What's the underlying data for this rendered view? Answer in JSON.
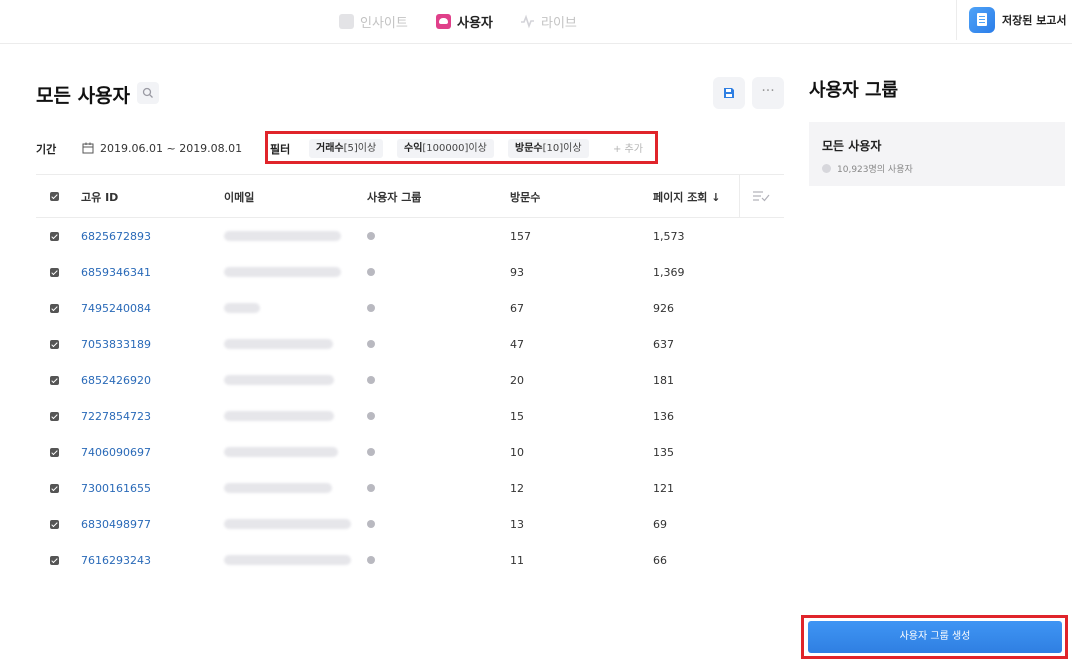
{
  "nav": {
    "tabs": [
      {
        "label": "인사이트",
        "icon": "lightbulb-icon"
      },
      {
        "label": "사용자",
        "icon": "users-icon"
      },
      {
        "label": "라이브",
        "icon": "pulse-icon"
      }
    ],
    "active_tab": "사용자",
    "saved_reports_label": "저장된 보고서"
  },
  "header": {
    "title": "모든 사용자"
  },
  "period": {
    "label": "기간",
    "value": "2019.06.01 ~ 2019.08.01"
  },
  "filters": {
    "label": "필터",
    "chips": [
      {
        "name": "거래수",
        "value": "[5]이상"
      },
      {
        "name": "수익",
        "value": "[100000]이상"
      },
      {
        "name": "방문수",
        "value": "[10]이상"
      }
    ],
    "add_label": "+ 추가"
  },
  "table": {
    "columns": [
      "고유 ID",
      "이메일",
      "사용자 그룹",
      "방문수",
      "페이지 조회 ↓"
    ],
    "rows": [
      {
        "id": "6825672893",
        "visits": "157",
        "pageviews": "1,573"
      },
      {
        "id": "6859346341",
        "visits": "93",
        "pageviews": "1,369"
      },
      {
        "id": "7495240084",
        "visits": "67",
        "pageviews": "926"
      },
      {
        "id": "7053833189",
        "visits": "47",
        "pageviews": "637"
      },
      {
        "id": "6852426920",
        "visits": "20",
        "pageviews": "181"
      },
      {
        "id": "7227854723",
        "visits": "15",
        "pageviews": "136"
      },
      {
        "id": "7406090697",
        "visits": "10",
        "pageviews": "135"
      },
      {
        "id": "7300161655",
        "visits": "12",
        "pageviews": "121"
      },
      {
        "id": "6830498977",
        "visits": "13",
        "pageviews": "69"
      },
      {
        "id": "7616293243",
        "visits": "11",
        "pageviews": "66"
      }
    ]
  },
  "side": {
    "title": "사용자 그룹",
    "group_name": "모든 사용자",
    "group_count": "10,923명의 사용자",
    "create_button": "사용자 그룹 생성"
  },
  "colors": {
    "accent": "#2f7fe2",
    "link": "#2a6ab8",
    "highlight_outline": "#e0242a",
    "active_tab_icon": "#e0408a"
  }
}
